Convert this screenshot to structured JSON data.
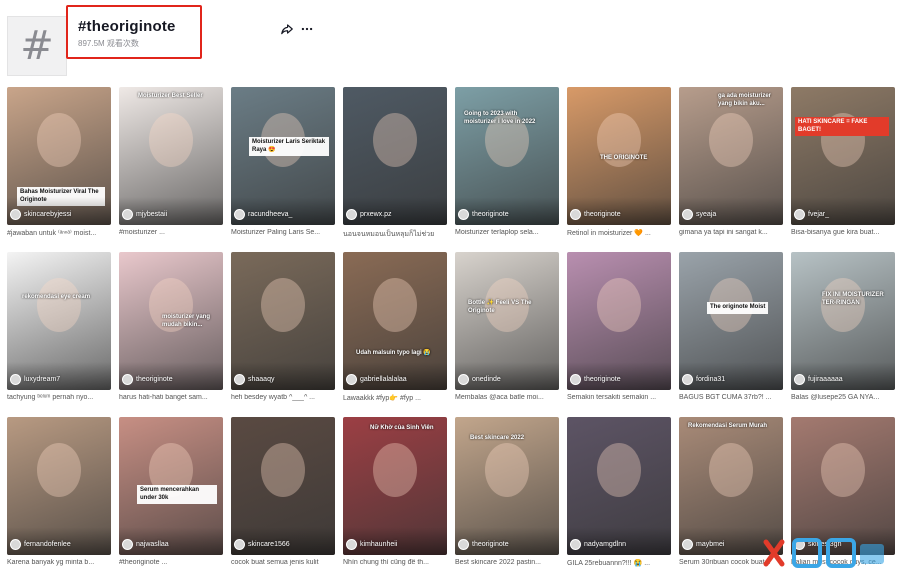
{
  "header": {
    "title": "#theoriginote",
    "views": "897.5M 观看次数",
    "avatar_icon": "hash-icon"
  },
  "actions": {
    "share_icon": "share-icon",
    "more_icon": "more-icon"
  },
  "videos": [
    {
      "user": "skincarebyjessi",
      "desc": "#jawaban untuk ⁽ᵃⁿⁿᵃ⁾ moist...",
      "caption": "Bahas Moisturizer Viral The Originote",
      "bg": "#c9a58a"
    },
    {
      "user": "mjybestaii",
      "desc": "#moisturizer ...",
      "caption": "Moisturizer Best Seller",
      "bg": "#efe9e6"
    },
    {
      "user": "racundheeva_",
      "desc": "Moisturizer Paling Laris Se...",
      "caption": "Moisturizer Laris Seriktak Raya 😍",
      "bg": "#6b7d86"
    },
    {
      "user": "prxewx.pz",
      "desc": "นอนจนหมอนเป็นหลุมก็ไม่ช่วย",
      "caption": "",
      "bg": "#4f5a64"
    },
    {
      "user": "theoriginote",
      "desc": "Moisturizer terlaplop sela...",
      "caption": "Going to 2023 with moisturizer i love in 2022",
      "bg": "#7d9fa6"
    },
    {
      "user": "theoriginote",
      "desc": "Retinol in moisturizer 🧡 ...",
      "caption": "THE ORIGINOTE",
      "bg": "#d89a68"
    },
    {
      "user": "syeaja",
      "desc": "gimana ya tapi ini sangat k...",
      "caption": "ga ada moisturizer yang bikin aku...",
      "bg": "#b79d8c"
    },
    {
      "user": "fvejar_",
      "desc": "Bisa-bisanya gue kira buat...",
      "caption": "HATI SKINCARE = FAKE BAGET!",
      "bg": "#8e7a66"
    },
    {
      "user": "luxydream7",
      "desc": "tachyung ᵇᵉˡᵘᵐ pernah nyo...",
      "caption": "rekomendasi eye cream",
      "bg": "#f4f4f4"
    },
    {
      "user": "theoriginote",
      "desc": "harus hati-hati banget sam...",
      "caption": "moisturizer yang mudah bikin...",
      "bg": "#e9c8cc"
    },
    {
      "user": "shaaaqy",
      "desc": "hefi besdey wyatb ^___^ ...",
      "caption": "",
      "bg": "#7a6a5a"
    },
    {
      "user": "gabriellalalalaa",
      "desc": "Lawaakkk #fyp👉 #fyp ...",
      "caption": "Udah malsuin typo lagi 😭",
      "bg": "#8a6b55"
    },
    {
      "user": "onedinde",
      "desc": "Membalas @aca batle moi...",
      "caption": "Bottle ✨ Feeli VS The Originote",
      "bg": "#d8d3cd"
    },
    {
      "user": "theoriginote",
      "desc": "Semakin tersakiti semakin ...",
      "caption": "",
      "bg": "#b98fb0"
    },
    {
      "user": "fordina31",
      "desc": "BAGUS BGT CUMA 37rb?! ...",
      "caption": "The originote Moist",
      "bg": "#9aa3aa"
    },
    {
      "user": "fujiraaaaaa",
      "desc": "Balas @lusepe25 GA NYA...",
      "caption": "FIX INI MOISTURIZER TER-RINGAN",
      "bg": "#b7c2c5"
    },
    {
      "user": "fernandofenlee",
      "desc": "Karena banyak yg minta b...",
      "caption": "",
      "bg": "#b89a82"
    },
    {
      "user": "najwasllaa",
      "desc": "#theoriginote ...",
      "caption": "Serum mencerahkan under 30k",
      "bg": "#c78f84"
    },
    {
      "user": "skincare1566",
      "desc": "cocok buat semua jenis kulit",
      "caption": "",
      "bg": "#5a4a42"
    },
    {
      "user": "kimhaunheii",
      "desc": "Nhìn chung thì cũng để th...",
      "caption": "Nữ Khờ của Sinh Viên",
      "bg": "#9c3f44"
    },
    {
      "user": "theoriginote",
      "desc": "Best skincare 2022 pastin...",
      "caption": "Best skincare 2022",
      "bg": "#c2a68c"
    },
    {
      "user": "nadyamgdlnn",
      "desc": "GILA 25rebuannn?!!! 😭 ...",
      "caption": "",
      "bg": "#5d5465"
    },
    {
      "user": "maybmei",
      "desc": "Serum 30ribuan cocok buat...",
      "caption": "Rekomendasi Serum Murah",
      "bg": "#a98b78"
    },
    {
      "user": "skinest3gn",
      "desc": "Kalian most cocok guys, ce...",
      "caption": "",
      "bg": "#a47a70"
    }
  ],
  "colors": {
    "highlight": "#e1251b",
    "text": "#161823",
    "muted": "#8a8b91"
  }
}
